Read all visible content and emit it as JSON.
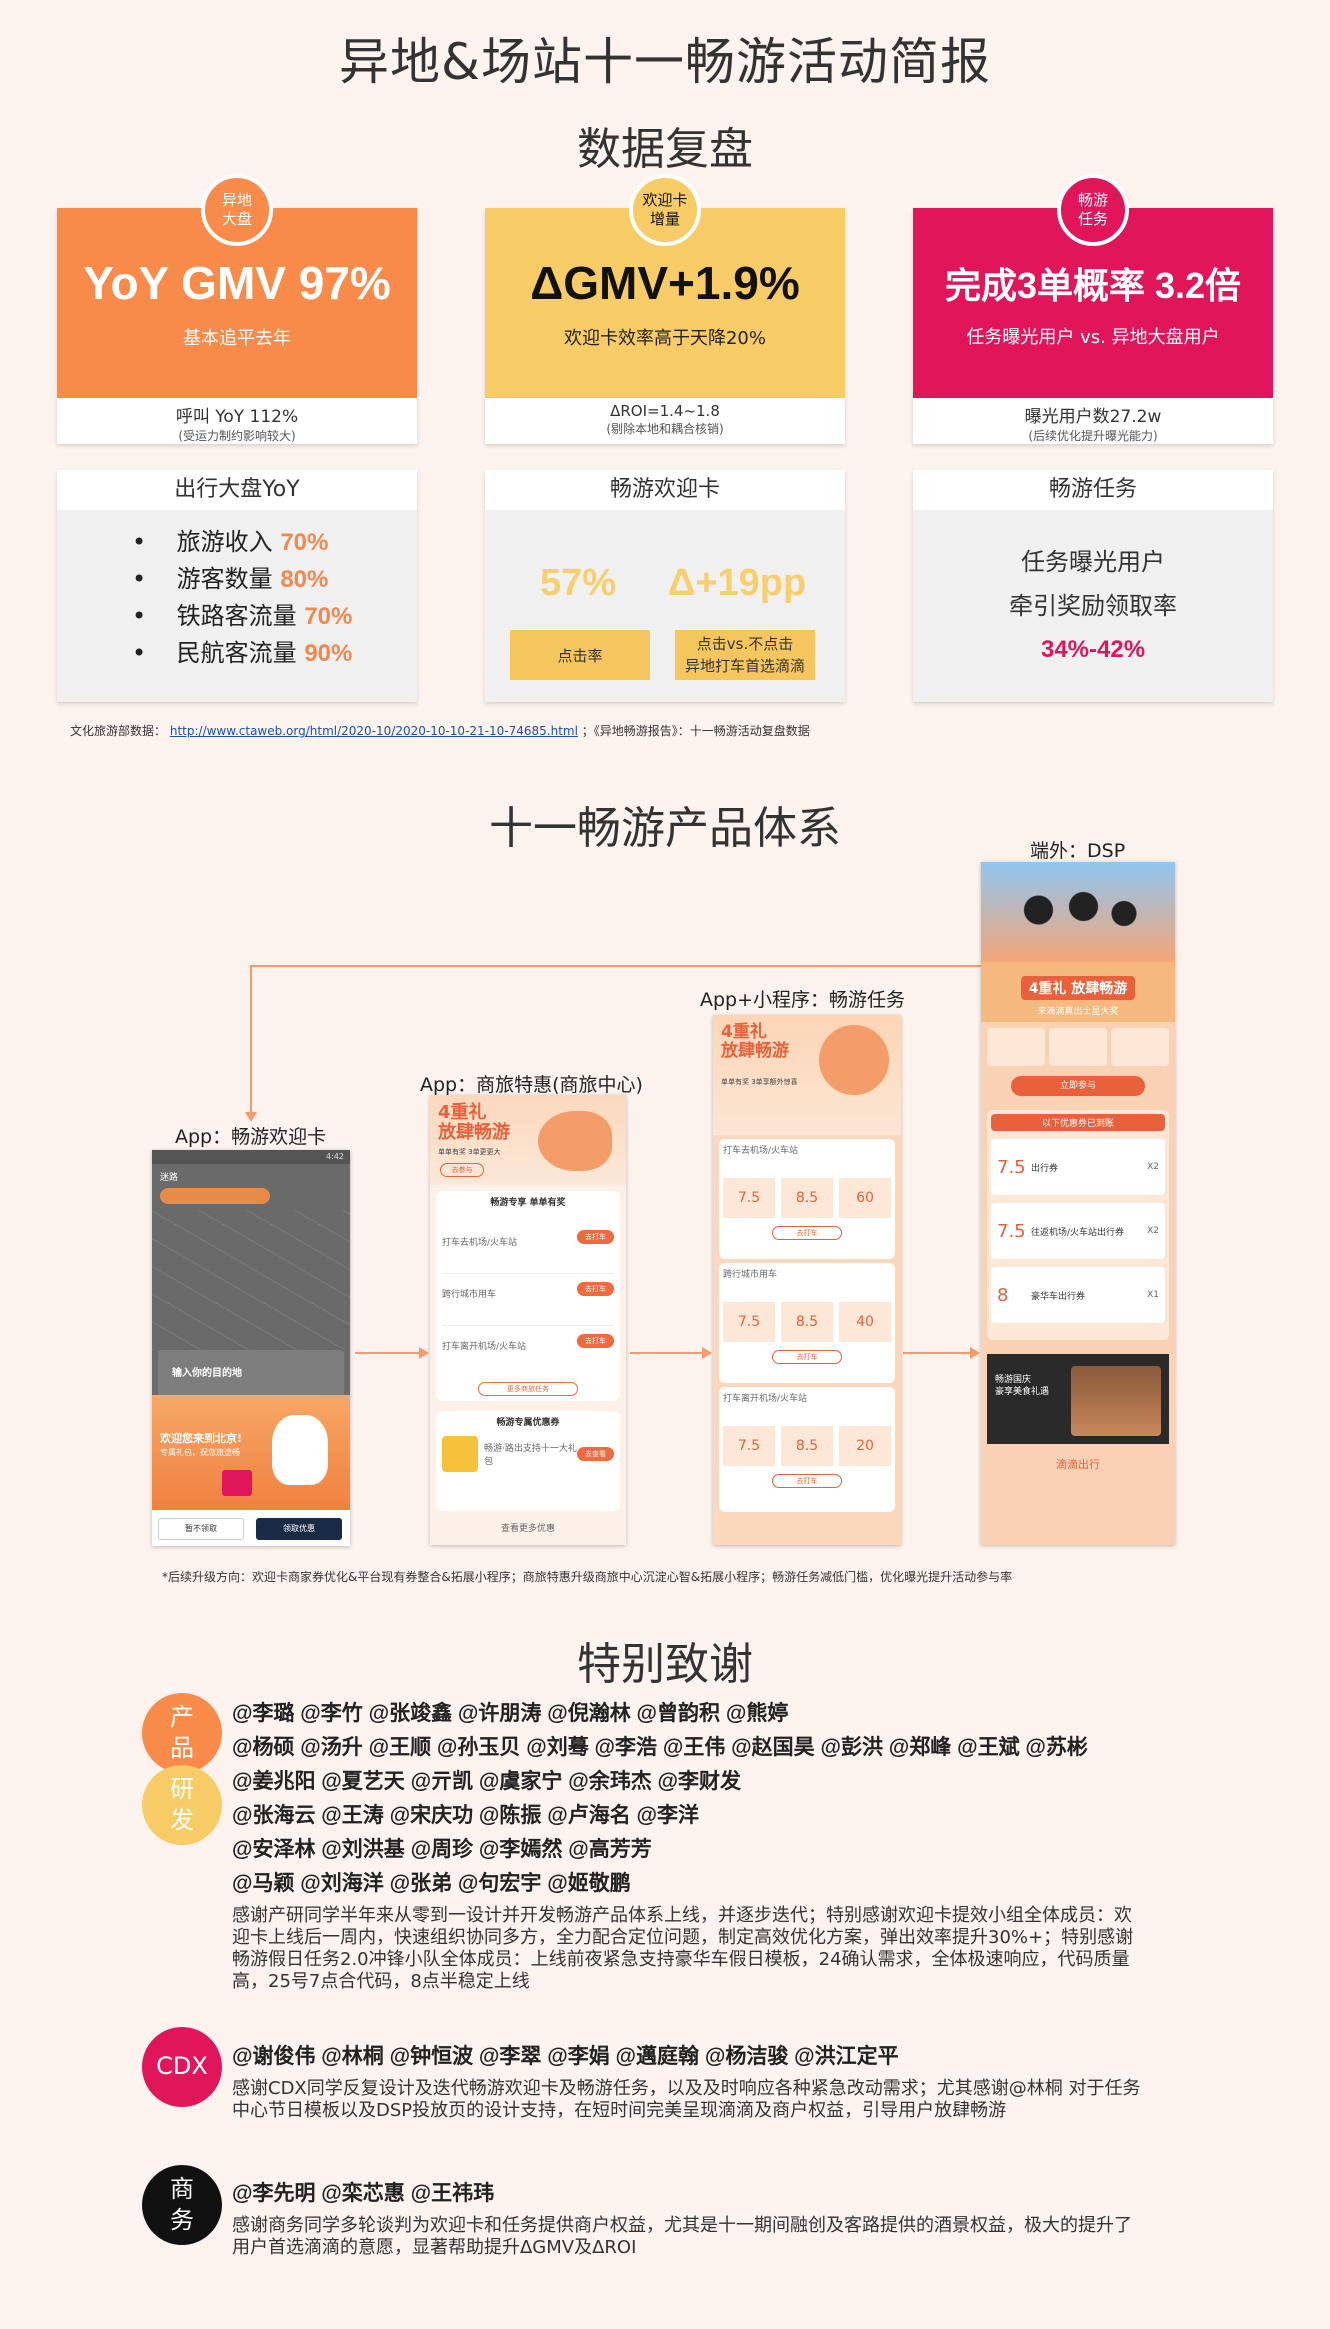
{
  "title": "异地&场站十一畅游活动简报",
  "section1_title": "数据复盘",
  "cards": [
    {
      "badge": "异地\n大盘",
      "big": "YoY GMV 97%",
      "sub": "基本追平去年",
      "line1": "呼叫 YoY 112%",
      "line2": "(受运力制约影响较大)",
      "color": "#f98b4a"
    },
    {
      "badge": "欢迎卡\n增量",
      "big": "ΔGMV+1.9%",
      "sub": "欢迎卡效率高于天降20%",
      "line1": "ΔROI=1.4~1.8",
      "line2": "(剔除本地和耦合核销)",
      "color": "#f7cc66"
    },
    {
      "badge": "畅游\n任务",
      "big": "完成3单概率  3.2倍",
      "sub": "任务曝光用户 vs. 异地大盘用户",
      "line1": "曝光用户数27.2w",
      "line2": "(后续优化提升曝光能力)",
      "color": "#e0155a"
    }
  ],
  "panel1": {
    "title": "出行大盘YoY",
    "items": [
      {
        "label": "旅游收入",
        "value": "70%"
      },
      {
        "label": "游客数量",
        "value": "80%"
      },
      {
        "label": "铁路客流量",
        "value": "70%"
      },
      {
        "label": "民航客流量",
        "value": "90%"
      }
    ]
  },
  "panel2": {
    "title": "畅游欢迎卡",
    "stat1": "57%",
    "stat2": "Δ+19pp",
    "tag1": "点击率",
    "tag2_l1": "点击vs.不点击",
    "tag2_l2": "异地打车首选滴滴"
  },
  "panel3": {
    "title": "畅游任务",
    "l1": "任务曝光用户",
    "l2": "牵引奖励领取率",
    "value": "34%-42%"
  },
  "source_note": {
    "prefix": "文化旅游部数据：",
    "link": "http://www.ctaweb.org/html/2020-10/2020-10-10-21-10-74685.html",
    "suffix": "；《异地畅游报告》：十一畅游活动复盘数据"
  },
  "section2_title": "十一畅游产品体系",
  "products": {
    "p1": "App：畅游欢迎卡",
    "p2": "App：商旅特惠(商旅中心)",
    "p3": "App+小程序：畅游任务",
    "p4": "端外：DSP"
  },
  "phone1": {
    "status": "4:42",
    "city": "迷路",
    "dest": "输入你的目的地",
    "promo": "欢迎您来到北京!",
    "promo_sub": "专属礼包，祝您旅途畅",
    "btn1": "暂不领取",
    "btn2": "领取优惠"
  },
  "phone2": {
    "headline": "4重礼\n放肆畅游",
    "tag": "单单有奖 3单更更大",
    "btn": "去参与",
    "sec1": "畅游专享 单单有奖",
    "rows": [
      "打车去机场/火车站",
      "跨行城市用车",
      "打车离开机场/火车站"
    ],
    "row_btn": "去打车",
    "more": "更多商旅任务",
    "sec2": "畅游专属优惠券",
    "coupon": "畅游·路出支持十一大礼包",
    "coupon_btn": "去查看",
    "foot": "查看更多优惠"
  },
  "phone3": {
    "headline": "4重礼\n放肆畅游",
    "sub": "单单有奖 3单享额外惊喜",
    "sections": [
      "打车去机场/火车站",
      "跨行城市用车",
      "打车离开机场/火车站"
    ],
    "vals": [
      [
        "7.5",
        "8.5",
        "60"
      ],
      [
        "7.5",
        "8.5",
        "40"
      ],
      [
        "7.5",
        "8.5",
        "20"
      ]
    ],
    "btn": "去打车"
  },
  "phone4": {
    "headline": "4重礼 放肆畅游",
    "sub": "来滴滴真出士星大奖",
    "btn": "立即参与",
    "coupon_header": "以下优惠券已到账",
    "coupons": [
      {
        "val": "7.5",
        "title": "出行券",
        "x": "X2"
      },
      {
        "val": "7.5",
        "title": "往返机场/火车站出行券",
        "x": "X2"
      },
      {
        "val": "8",
        "title": "豪华车出行券",
        "x": "X1"
      }
    ],
    "banner": "畅游国庆\n豪享美食礼遇",
    "logo": "滴滴出行"
  },
  "future_note": "*后续升级方向：欢迎卡商家券优化&平台现有券整合&拓展小程序；商旅特惠升级商旅中心沉淀心智&拓展小程序；畅游任务减低门槛，优化曝光提升活动参与率",
  "section3_title": "特别致谢",
  "thanks": {
    "product_label": "产\n品",
    "dev_label": "研\n发",
    "product_dev_names": [
      "@李璐 @李竹 @张竣鑫 @许朋涛 @倪瀚林 @曾韵积 @熊婷",
      "@杨硕 @汤升 @王顺 @孙玉贝 @刘蓦 @李浩 @王伟 @赵国昊 @彭洪 @郑峰 @王斌 @苏彬",
      "@姜兆阳 @夏艺天 @亓凯 @虞家宁 @余玮杰 @李财发",
      "@张海云 @王涛 @宋庆功 @陈振 @卢海名 @李洋",
      "@安泽林 @刘洪基 @周珍 @李嫣然 @高芳芳",
      "@马颖 @刘海洋 @张弟 @句宏宇 @姬敬鹏"
    ],
    "product_dev_text": "感谢产研同学半年来从零到一设计并开发畅游产品体系上线，并逐步迭代；特别感谢欢迎卡提效小组全体成员：欢迎卡上线后一周内，快速组织协同多方，全力配合定位问题，制定高效优化方案，弹出效率提升30%+；特别感谢畅游假日任务2.0冲锋小队全体成员：上线前夜紧急支持豪华车假日模板，24确认需求，全体极速响应，代码质量高，25号7点合代码，8点半稳定上线",
    "cdx_label": "CDX",
    "cdx_names": "@谢俊伟 @林桐 @钟恒波 @李翠 @李娟 @邁庭翰 @杨洁骏 @洪江定平",
    "cdx_text": "感谢CDX同学反复设计及迭代畅游欢迎卡及畅游任务，以及及时响应各种紧急改动需求；尤其感谢@林桐 对于任务中心节日模板以及DSP投放页的设计支持，在短时间完美呈现滴滴及商户权益，引导用户放肆畅游",
    "biz_label": "商\n务",
    "biz_names": "@李先明 @栾芯惠 @王祎玮",
    "biz_text": "感谢商务同学多轮谈判为欢迎卡和任务提供商户权益，尤其是十一期间融创及客路提供的酒景权益，极大的提升了用户首选滴滴的意愿，显著帮助提升ΔGMV及ΔROI"
  }
}
